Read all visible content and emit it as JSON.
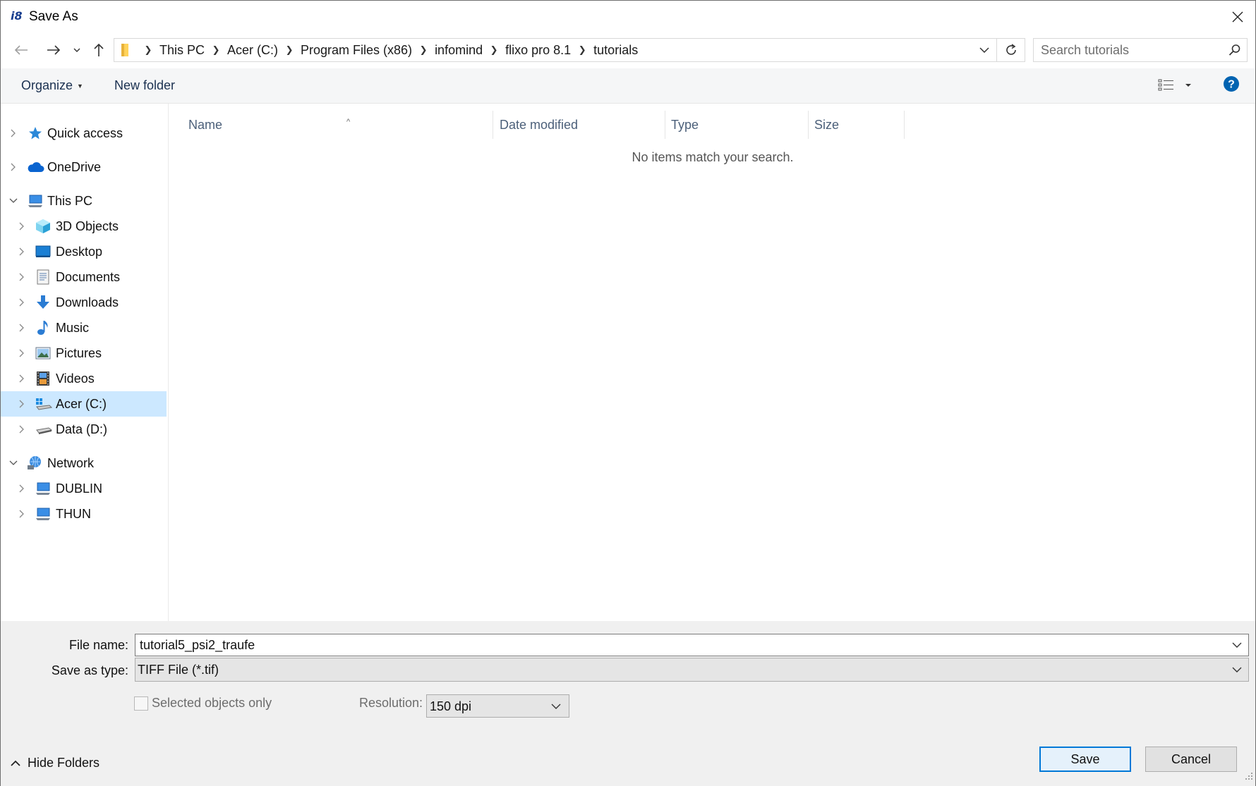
{
  "window": {
    "title": "Save As",
    "app_logo_text": "i8",
    "app_logo_color": "#1a3f8f"
  },
  "navigation": {
    "back_icon": "arrow-left-icon",
    "forward_icon": "arrow-right-icon",
    "recent_icon": "chevron-down-icon",
    "up_icon": "arrow-up-icon"
  },
  "address_bar": {
    "breadcrumbs": [
      "This PC",
      "Acer (C:)",
      "Program Files (x86)",
      "infomind",
      "flixo pro 8.1",
      "tutorials"
    ]
  },
  "search": {
    "placeholder": "Search tutorials"
  },
  "command_bar": {
    "organize_label": "Organize",
    "new_folder_label": "New folder",
    "help_color": "#0063b1"
  },
  "sidebar": {
    "items": [
      {
        "label": "Quick access",
        "icon": "star-icon",
        "level": 0,
        "expanded": false
      },
      {
        "label": "OneDrive",
        "icon": "cloud-icon",
        "level": 0,
        "expanded": false
      },
      {
        "label": "This PC",
        "icon": "computer-icon",
        "level": 0,
        "expanded": true
      },
      {
        "label": "3D Objects",
        "icon": "cube-icon",
        "level": 1,
        "expanded": false
      },
      {
        "label": "Desktop",
        "icon": "desktop-icon",
        "level": 1,
        "expanded": false
      },
      {
        "label": "Documents",
        "icon": "document-icon",
        "level": 1,
        "expanded": false
      },
      {
        "label": "Downloads",
        "icon": "download-icon",
        "level": 1,
        "expanded": false
      },
      {
        "label": "Music",
        "icon": "music-note-icon",
        "level": 1,
        "expanded": false
      },
      {
        "label": "Pictures",
        "icon": "picture-icon",
        "level": 1,
        "expanded": false
      },
      {
        "label": "Videos",
        "icon": "film-icon",
        "level": 1,
        "expanded": false
      },
      {
        "label": "Acer (C:)",
        "icon": "windows-drive-icon",
        "level": 1,
        "expanded": false,
        "selected": true
      },
      {
        "label": "Data (D:)",
        "icon": "drive-icon",
        "level": 1,
        "expanded": false
      },
      {
        "label": "Network",
        "icon": "network-icon",
        "level": 0,
        "expanded": true
      },
      {
        "label": "DUBLIN",
        "icon": "computer-icon",
        "level": 1,
        "expanded": false
      },
      {
        "label": "THUN",
        "icon": "computer-icon",
        "level": 1,
        "expanded": false
      }
    ],
    "selected_color": "#cce8ff"
  },
  "file_list": {
    "columns": [
      "Name",
      "Date modified",
      "Type",
      "Size"
    ],
    "empty_message": "No items match your search."
  },
  "form": {
    "file_name_label": "File name:",
    "file_name_value": "tutorial5_psi2_traufe",
    "save_type_label": "Save as type:",
    "save_type_value": "TIFF File (*.tif)",
    "selected_only_label": "Selected objects only",
    "selected_only_checked": false,
    "resolution_label": "Resolution:",
    "resolution_value": "150 dpi"
  },
  "footer": {
    "hide_folders_label": "Hide Folders",
    "save_label": "Save",
    "cancel_label": "Cancel",
    "accent_color": "#0078d7"
  }
}
